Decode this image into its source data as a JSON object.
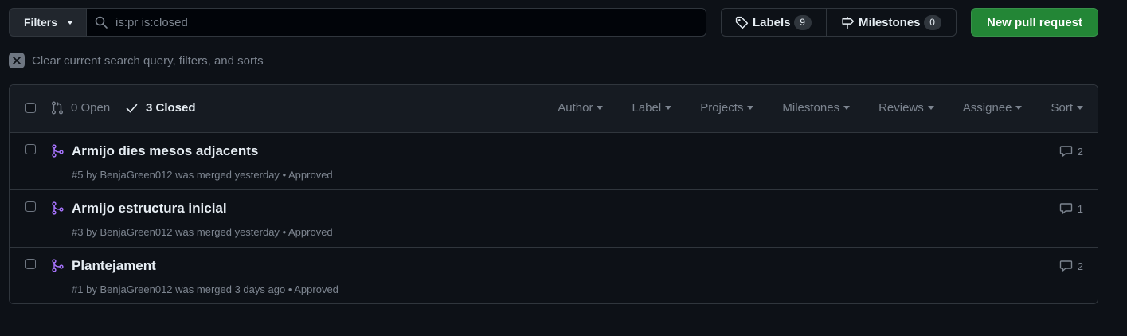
{
  "topbar": {
    "filters_label": "Filters",
    "search_value": "is:pr is:closed",
    "labels_label": "Labels",
    "labels_count": "9",
    "milestones_label": "Milestones",
    "milestones_count": "0",
    "new_pr_label": "New pull request"
  },
  "clear_query": {
    "label": "Clear current search query, filters, and sorts"
  },
  "list_header": {
    "open_label": "0 Open",
    "closed_label": "3 Closed",
    "filters": [
      "Author",
      "Label",
      "Projects",
      "Milestones",
      "Reviews",
      "Assignee",
      "Sort"
    ]
  },
  "pull_requests": [
    {
      "title": "Armijo dies mesos adjacents",
      "number": "#5",
      "by": "by",
      "author": "BenjaGreen012",
      "merged_text": "was merged yesterday",
      "review_status": "• Approved",
      "comments": "2"
    },
    {
      "title": "Armijo estructura inicial",
      "number": "#3",
      "by": "by",
      "author": "BenjaGreen012",
      "merged_text": "was merged yesterday",
      "review_status": "• Approved",
      "comments": "1"
    },
    {
      "title": "Plantejament",
      "number": "#1",
      "by": "by",
      "author": "BenjaGreen012",
      "merged_text": "was merged 3 days ago",
      "review_status": "• Approved",
      "comments": "2"
    }
  ],
  "colors": {
    "background": "#0d1117",
    "header_bg": "#161b22",
    "border": "#30363d",
    "muted_text": "#7d8590",
    "primary_button": "#238636",
    "merged_purple": "#a371f7"
  },
  "icons": {
    "search": "search-icon",
    "labels": "tag-icon",
    "milestones": "milestone-icon",
    "open_pr": "git-pull-request-icon",
    "closed": "check-icon",
    "merged": "git-merge-icon",
    "comments": "comment-icon",
    "clear": "x-icon"
  }
}
